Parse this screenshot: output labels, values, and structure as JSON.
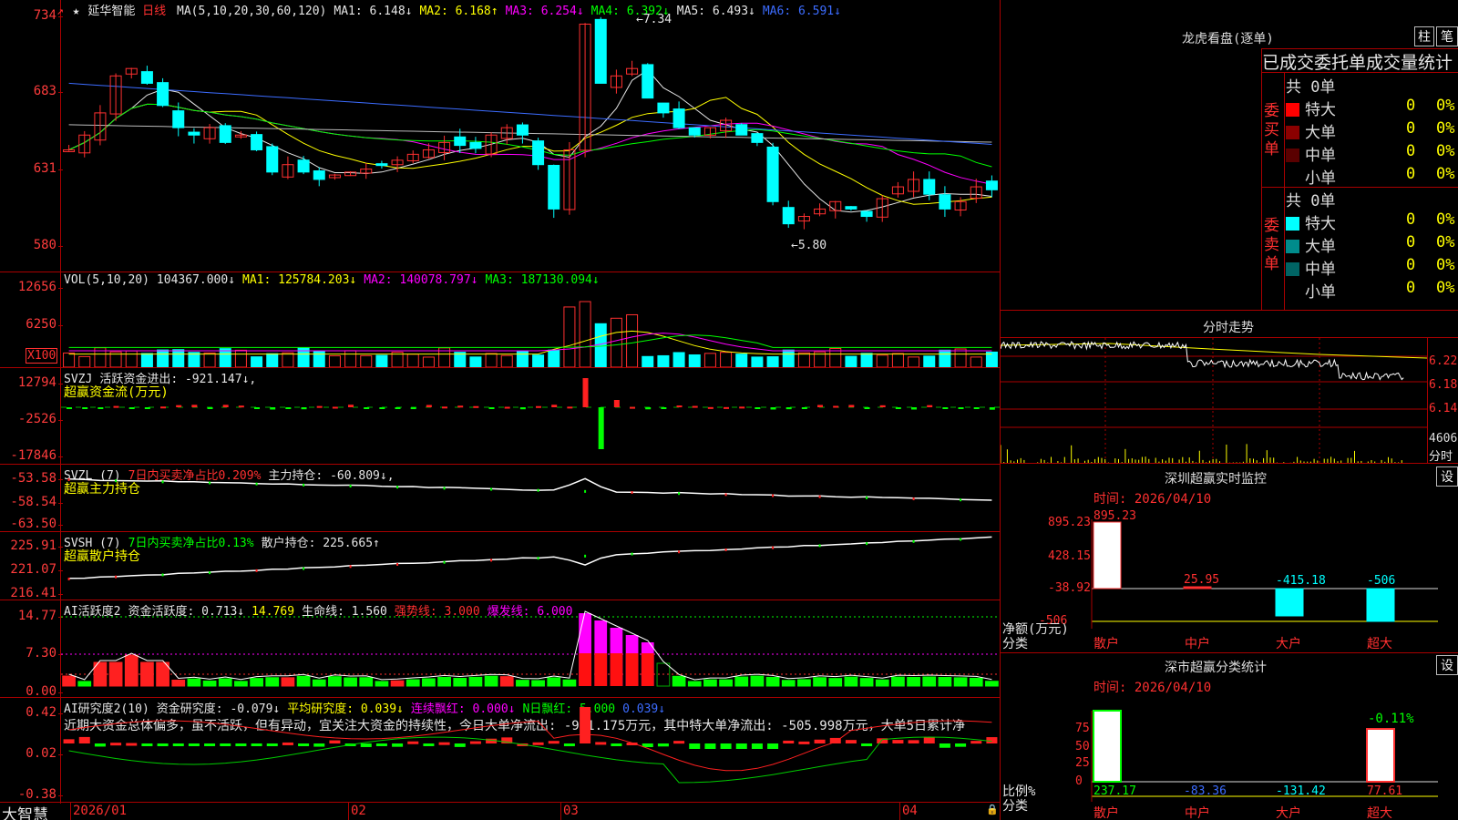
{
  "stock": {
    "star": "★",
    "name": "延华智能",
    "period": "日线"
  },
  "price_panel": {
    "ma_legend": [
      {
        "text": "MA(5,10,20,30,60,120)",
        "color": "#e6e6e6"
      },
      {
        "text": "MA1: 6.148↓",
        "color": "#e6e6e6"
      },
      {
        "text": "MA2: 6.168↑",
        "color": "#ffff00"
      },
      {
        "text": "MA3: 6.254↓",
        "color": "#ff00ff"
      },
      {
        "text": "MA4: 6.392↓",
        "color": "#00ff00"
      },
      {
        "text": "MA5: 6.493↓",
        "color": "#e6e6e6"
      },
      {
        "text": "MA6: 6.591↓",
        "color": "#3c6cff"
      }
    ],
    "y_labels": [
      "734",
      "683",
      "631",
      "580"
    ],
    "high_label": "←7.34",
    "low_label": "←5.80"
  },
  "vol_panel": {
    "legend": [
      {
        "text": "VOL(5,10,20)",
        "color": "#e6e6e6"
      },
      {
        "text": "104367.000↓",
        "color": "#e6e6e6"
      },
      {
        "text": "MA1: 125784.203↓",
        "color": "#ffff00"
      },
      {
        "text": "MA2: 140078.797↓",
        "color": "#ff00ff"
      },
      {
        "text": "MA3: 187130.094↓",
        "color": "#00ff00"
      }
    ],
    "y_labels": [
      "12656",
      "6250"
    ],
    "unit": "X100"
  },
  "svzj_panel": {
    "legend": [
      {
        "text": "SVZJ",
        "color": "#e6e6e6"
      },
      {
        "text": "活跃资金进出: -921.147↓,",
        "color": "#e6e6e6"
      }
    ],
    "sub": "超赢资金流(万元)",
    "y_labels": [
      "12794",
      "-2526",
      "-17846"
    ]
  },
  "svzl_panel": {
    "legend": [
      {
        "text": "SVZL (7)",
        "color": "#e6e6e6"
      },
      {
        "text": "7日内买卖净占比0.209%",
        "color": "#ff3030"
      },
      {
        "text": "主力持仓: -60.809↓,",
        "color": "#e6e6e6"
      }
    ],
    "sub": "超赢主力持仓",
    "y_labels": [
      "-53.58",
      "-58.54",
      "-63.50"
    ]
  },
  "svsh_panel": {
    "legend": [
      {
        "text": "SVSH (7)",
        "color": "#e6e6e6"
      },
      {
        "text": "7日内买卖净占比0.13%",
        "color": "#00ff00"
      },
      {
        "text": "散户持仓: 225.665↑",
        "color": "#e6e6e6"
      }
    ],
    "sub": "超赢散户持仓",
    "y_labels": [
      "225.91",
      "221.07",
      "216.41"
    ]
  },
  "ai_active_panel": {
    "legend": [
      {
        "text": "AI活跃度2",
        "color": "#e6e6e6"
      },
      {
        "text": "资金活跃度: 0.713↓",
        "color": "#e6e6e6"
      },
      {
        "text": "14.769",
        "color": "#ffff00"
      },
      {
        "text": "生命线: 1.560",
        "color": "#e6e6e6"
      },
      {
        "text": "强势线: 3.000",
        "color": "#ff3030"
      },
      {
        "text": "爆发线: 6.000",
        "color": "#ff00ff"
      }
    ],
    "y_labels": [
      "14.77",
      "7.30",
      "0.00"
    ]
  },
  "ai_research_panel": {
    "legend": [
      {
        "text": "AI研究度2(10)",
        "color": "#e6e6e6"
      },
      {
        "text": "资金研究度: -0.079↓",
        "color": "#e6e6e6"
      },
      {
        "text": "平均研究度: 0.039↓",
        "color": "#ffff00"
      },
      {
        "text": "连续飘红: 0.000↓",
        "color": "#ff00ff"
      },
      {
        "text": "N日飘红: 5.000",
        "color": "#00ff00"
      },
      {
        "text": "0.039↓",
        "color": "#3c6cff"
      }
    ],
    "comment": "近期大资金总体偏多，虽不活跃，但有异动，宜关注大资金的持续性，今日大单净流出: -921.175万元，其中特大单净流出: -505.998万元，大单5日累计净",
    "y_labels": [
      "0.42",
      "0.02",
      "-0.38"
    ]
  },
  "x_axis": {
    "labels": [
      "2026/01",
      "02",
      "03",
      "04"
    ],
    "brand": "大智慧"
  },
  "dragon_tiger": {
    "title": "龙虎看盘(逐单)",
    "btn_bar": "柱",
    "btn_stroke": "笔",
    "header": "已成交委托单成交量统计",
    "buy_label": "委买单",
    "sell_label": "委卖单",
    "buy_total": "共 0单",
    "sell_total": "共 0单",
    "buy_rows": [
      {
        "label": "特大",
        "count": "0",
        "pct": "0%",
        "color": "#ff0000"
      },
      {
        "label": "大单",
        "count": "0",
        "pct": "0%",
        "color": "#8b0000"
      },
      {
        "label": "中单",
        "count": "0",
        "pct": "0%",
        "color": "#5a0000"
      },
      {
        "label": "小单",
        "count": "0",
        "pct": "0%",
        "color": "#000000"
      }
    ],
    "sell_rows": [
      {
        "label": "特大",
        "count": "0",
        "pct": "0%",
        "color": "#00ffff"
      },
      {
        "label": "大单",
        "count": "0",
        "pct": "0%",
        "color": "#008b8b"
      },
      {
        "label": "中单",
        "count": "0",
        "pct": "0%",
        "color": "#006464"
      },
      {
        "label": "小单",
        "count": "0",
        "pct": "0%",
        "color": "#000000"
      }
    ]
  },
  "intraday": {
    "title": "分时走势",
    "y_labels": [
      "6.22",
      "6.18",
      "6.14"
    ],
    "vol_label": "4606",
    "unit": "分时"
  },
  "sz_monitor": {
    "title": "深圳超赢实时监控",
    "btn": "设",
    "time": "时间: 2026/04/10",
    "y_labels": [
      "895.23",
      "428.15",
      "-38.92",
      "-506"
    ],
    "y_title": "净额(万元)",
    "x_title": "分类",
    "categories": [
      "散户",
      "中户",
      "大户",
      "超大"
    ],
    "values": [
      "895.23",
      "25.95",
      "-415.18",
      "-506"
    ]
  },
  "sz_class": {
    "title": "深市超赢分类统计",
    "btn": "设",
    "time": "时间: 2026/04/10",
    "y_labels": [
      "75",
      "50",
      "25",
      "0"
    ],
    "y_title": "比例%",
    "x_title": "分类",
    "categories": [
      "散户",
      "中户",
      "大户",
      "超大"
    ],
    "values": [
      "237.17",
      "-83.36",
      "-131.42",
      "77.61"
    ],
    "top_label": "-0.11%"
  }
}
